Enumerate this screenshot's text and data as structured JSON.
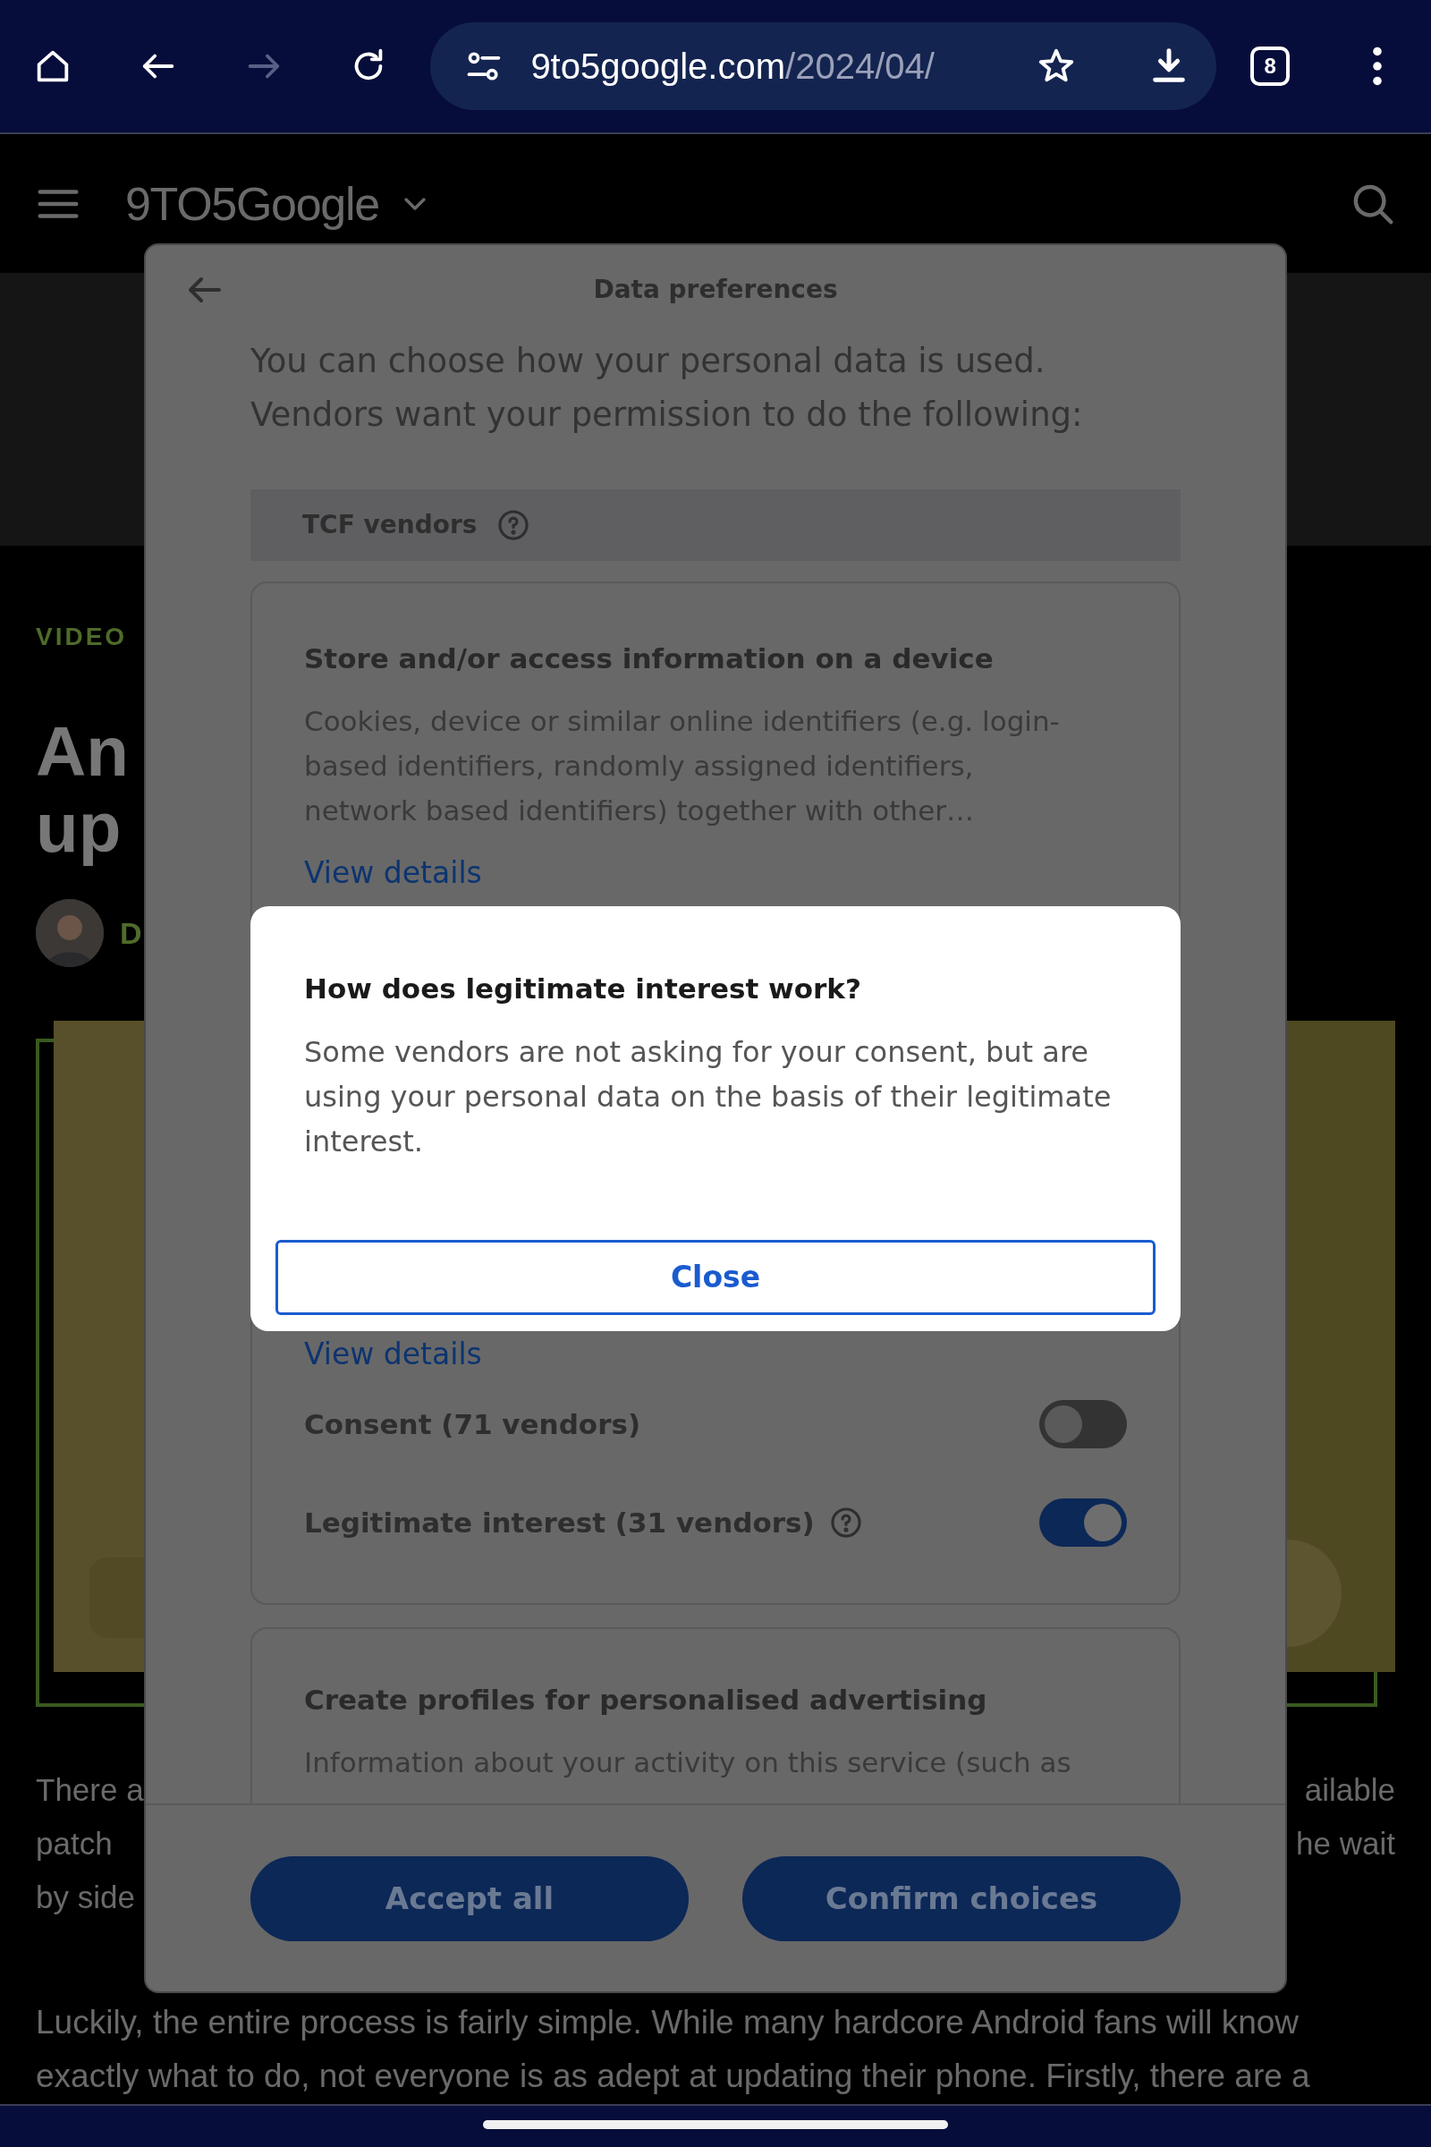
{
  "browser": {
    "toolbar": [
      {
        "kind": "home",
        "disabled": false
      },
      {
        "kind": "back",
        "disabled": false
      },
      {
        "kind": "forward",
        "disabled": true
      },
      {
        "kind": "reload",
        "disabled": false
      }
    ],
    "address": {
      "host": "9to5google.com",
      "path": "/2024/04/"
    },
    "tab_count": "8"
  },
  "site_header": {
    "logo": "9TO5Google"
  },
  "article": {
    "category": "VIDEO",
    "headline_lines": [
      "An",
      "up"
    ],
    "author": "D",
    "paragraph_1_lines": [
      {
        "left": "There a",
        "right": "ailable"
      },
      {
        "left": "patch",
        "right": "he wait"
      },
      {
        "left": "by side"
      }
    ],
    "paragraph_2": "Luckily, the entire process is fairly simple. While many hardcore Android fans will know\nexactly what to do, not everyone is as adept at updating their phone. Firstly, there are a"
  },
  "dialog": {
    "title": "Data preferences",
    "intro": "You can choose how your personal data is used.\nVendors want your permission to do the following:",
    "section": "TCF vendors",
    "purposes": [
      {
        "title": "Store and/or access information on a device",
        "description": "Cookies, device or similar online identifiers (e.g. login-\nbased identifiers, randomly assigned identifiers,\nnetwork based identifiers) together with other…",
        "link": "View details"
      },
      {
        "link": "View details",
        "toggles": [
          {
            "label": "Consent (71 vendors)",
            "on": false,
            "help": false
          },
          {
            "label": "Legitimate interest (31 vendors)",
            "on": true,
            "help": true
          }
        ]
      },
      {
        "title": "Create profiles for personalised advertising",
        "description": "Information about your activity on this service (such as"
      }
    ],
    "buttons": [
      "Accept all",
      "Confirm choices"
    ]
  },
  "popup": {
    "title": "How does legitimate interest work?",
    "body": "Some vendors are not asking for your consent, but are\nusing your personal data on the basis of their legitimate\ninterest.",
    "button": "Close"
  }
}
